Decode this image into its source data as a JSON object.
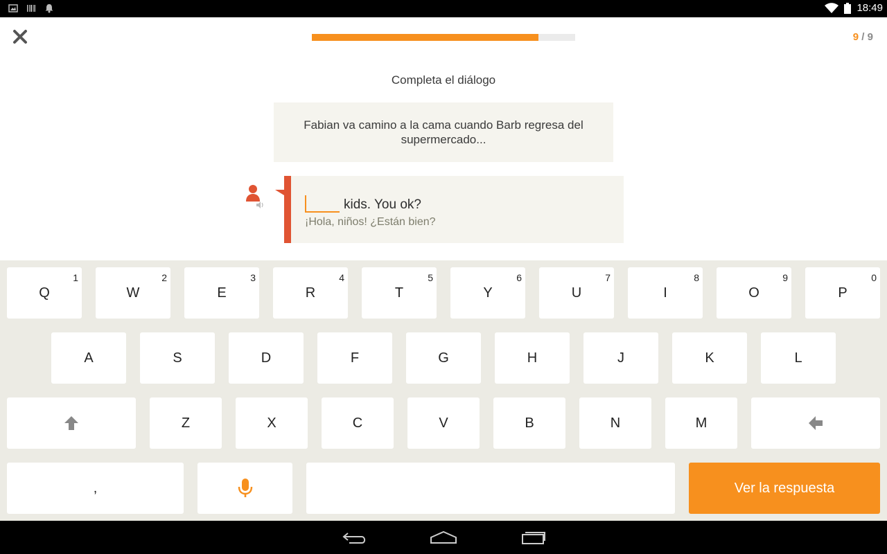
{
  "status_bar": {
    "time": "18:49"
  },
  "header": {
    "progress_fraction": 0.86,
    "counter_current": "9",
    "counter_sep": " / ",
    "counter_total": "9"
  },
  "exercise": {
    "instruction": "Completa el diálogo",
    "context": "Fabian va camino a la cama cuando Barb regresa del supermercado...",
    "english_line": "kids. You ok?",
    "spanish_line": "¡Hola, niños! ¿Están bien?"
  },
  "keyboard": {
    "row1": [
      {
        "label": "Q",
        "num": "1"
      },
      {
        "label": "W",
        "num": "2"
      },
      {
        "label": "E",
        "num": "3"
      },
      {
        "label": "R",
        "num": "4"
      },
      {
        "label": "T",
        "num": "5"
      },
      {
        "label": "Y",
        "num": "6"
      },
      {
        "label": "U",
        "num": "7"
      },
      {
        "label": "I",
        "num": "8"
      },
      {
        "label": "O",
        "num": "9"
      },
      {
        "label": "P",
        "num": "0"
      }
    ],
    "row2": [
      "A",
      "S",
      "D",
      "F",
      "G",
      "H",
      "J",
      "K",
      "L"
    ],
    "row3": [
      "Z",
      "X",
      "C",
      "V",
      "B",
      "N",
      "M"
    ],
    "comma": ",",
    "action_label": "Ver la respuesta"
  },
  "colors": {
    "accent": "#f7901e",
    "speaker": "#e05433",
    "bubble_bg": "#f5f4ee"
  }
}
